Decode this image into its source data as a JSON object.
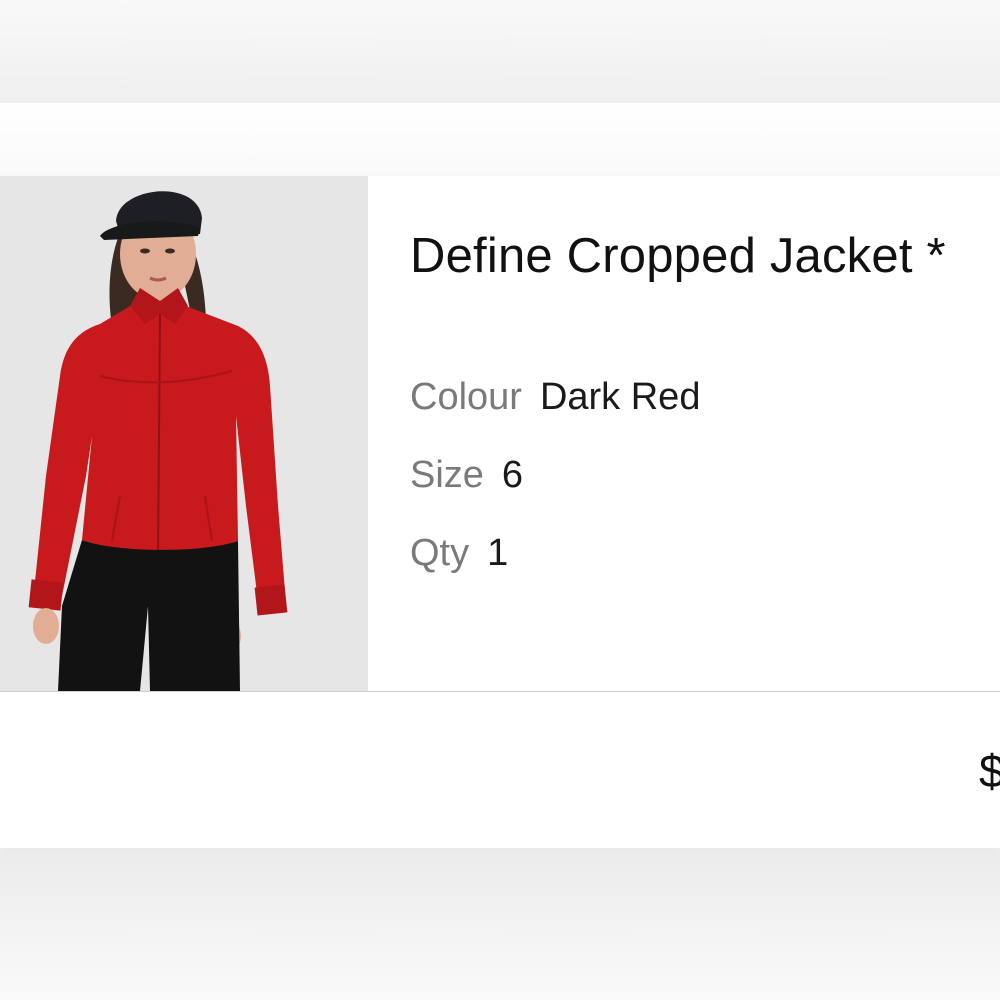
{
  "product": {
    "title": "Define Cropped Jacket *",
    "image_alt": "Model wearing red cropped jacket, black cap and black shorts",
    "attributes": {
      "colour_label": "Colour",
      "colour_value": "Dark Red",
      "size_label": "Size",
      "size_value": "6",
      "qty_label": "Qty",
      "qty_value": "1"
    },
    "price_visible": "$"
  },
  "colors": {
    "jacket": "#c8191c",
    "shorts": "#121212",
    "cap": "#1e1f22",
    "image_bg": "#e6e6e6",
    "label_gray": "#7a7a7a",
    "text_dark": "#111111"
  }
}
